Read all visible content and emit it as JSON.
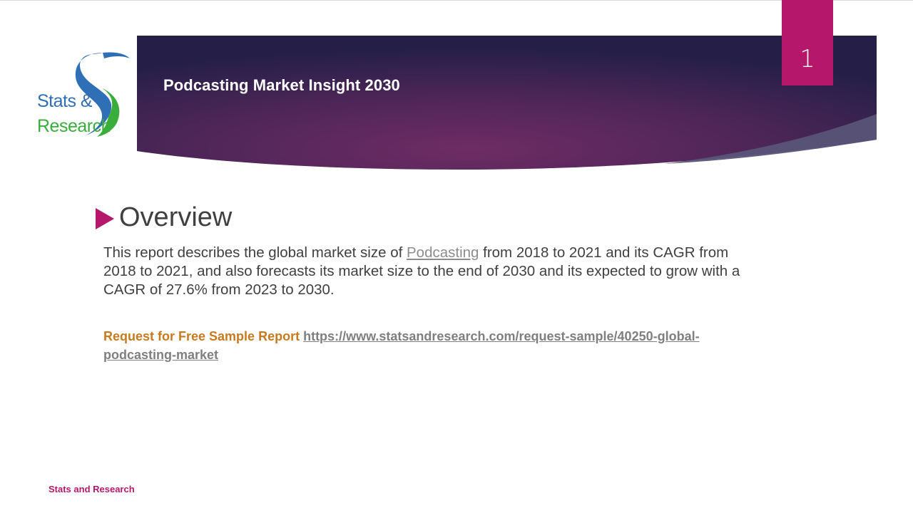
{
  "logo": {
    "line1": "Stats &",
    "line2": "Research"
  },
  "header": {
    "title": "Podcasting Market Insight 2030",
    "page_number": "1"
  },
  "section": {
    "title": "Overview"
  },
  "body": {
    "part1": "This report describes the global market size of ",
    "link_text": "Podcasting",
    "part2": " from 2018 to 2021 and its CAGR from 2018 to 2021, and also forecasts its market size to the end of 2030 and its expected to grow with a CAGR of 27.6% from 2023 to 2030."
  },
  "cta": {
    "label": "Request for Free Sample Report",
    "url": "https://www.statsandresearch.com/request-sample/40250-global-podcasting-market"
  },
  "footer": {
    "brand": "Stats and Research"
  },
  "colors": {
    "accent": "#b5186a",
    "banner_dark": "#2a1f4a",
    "banner_mid": "#6b2c63",
    "cta_label": "#c77a1e",
    "link": "#8c8c8c"
  }
}
